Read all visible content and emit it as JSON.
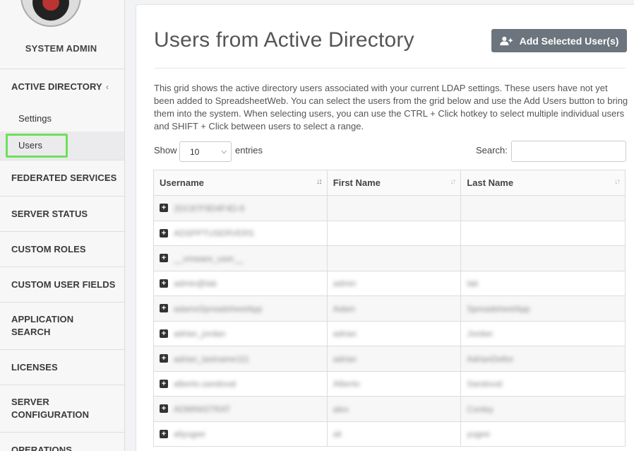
{
  "sidebar": {
    "role_label": "SYSTEM ADMIN",
    "items": [
      {
        "label": "ACTIVE DIRECTORY",
        "chevron": "‹"
      },
      {
        "label": "FEDERATED SERVICES",
        "chevron": "‹"
      },
      {
        "label": "SERVER STATUS"
      },
      {
        "label": "CUSTOM ROLES"
      },
      {
        "label": "CUSTOM USER FIELDS"
      },
      {
        "label": "APPLICATION SEARCH"
      },
      {
        "label": "LICENSES"
      },
      {
        "label": "SERVER CONFIGURATION"
      },
      {
        "label": "OPERATIONS"
      }
    ],
    "sub_items": [
      {
        "label": "Settings"
      },
      {
        "label": "Users"
      }
    ]
  },
  "main": {
    "title": "Users from Active Directory",
    "add_button_label": "Add Selected User(s)",
    "description": "This grid shows the active directory users associated with your current LDAP settings. These users have not yet been added to SpreadsheetWeb. You can select the users from the grid below and use the Add Users button to bring them into the system. When selecting users, you can use the CTRL + Click hotkey to select multiple individual users and SHIFT + Click between users to select a range.",
    "show_label": "Show",
    "entries_value": "10",
    "entries_label": "entries",
    "search_label": "Search:",
    "search_value": ""
  },
  "table": {
    "headers": [
      "Username",
      "First Name",
      "Last Name"
    ],
    "rows": [
      [
        "2DC87F9D4F4D-9",
        "",
        ""
      ],
      [
        "ADSPPTUSERVERS",
        "",
        ""
      ],
      [
        "__vmware_user__",
        "",
        ""
      ],
      [
        "admin@lab",
        "admin",
        "lab"
      ],
      [
        "adamsSpreadsheetApp",
        "Adam",
        "SpreadsheetApp"
      ],
      [
        "adrian_jordan",
        "adrian",
        "Jordan"
      ],
      [
        "adrian_lastname111",
        "adrian",
        "AdrianDellor"
      ],
      [
        "alberto.sandoval",
        "Alberto",
        "Sandoval"
      ],
      [
        "ADMINISTRAT",
        "alex",
        "Conley"
      ],
      [
        "aliyugee",
        "ali",
        "yugee"
      ]
    ]
  },
  "colors": {
    "accent_button": "#6c757d",
    "highlight_outline": "#6ee05a"
  }
}
